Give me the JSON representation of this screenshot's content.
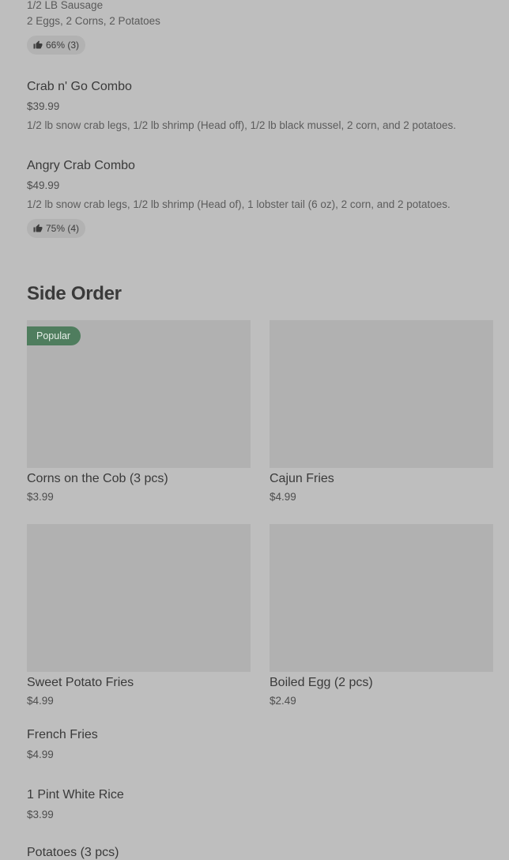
{
  "prev_item": {
    "line1": "1/2 LB Sausage",
    "line2": "2 Eggs, 2 Corns, 2 Potatoes",
    "rating": "66% (3)"
  },
  "items": [
    {
      "title": "Crab n' Go Combo",
      "price": "$39.99",
      "desc": "1/2 lb snow crab legs, 1/2 lb shrimp (Head off), 1/2 lb black mussel, 2 corn, and 2 potatoes."
    },
    {
      "title": "Angry Crab Combo",
      "price": "$49.99",
      "desc": "1/2 lb snow crab legs, 1/2 lb shrimp (Head of), 1 lobster tail (6 oz), 2 corn, and 2 potatoes.",
      "rating": "75% (4)"
    }
  ],
  "side_order": {
    "title": "Side Order",
    "popular_badge": "Popular",
    "cards": [
      {
        "title": "Corns on the Cob (3 pcs)",
        "price": "$3.99"
      },
      {
        "title": "Cajun Fries",
        "price": "$4.99"
      },
      {
        "title": "Sweet Potato Fries",
        "price": "$4.99"
      },
      {
        "title": "Boiled Egg (2 pcs)",
        "price": "$2.49"
      }
    ],
    "list": [
      {
        "title": "French Fries",
        "price": "$4.99"
      },
      {
        "title": "1 Pint White Rice",
        "price": "$3.99"
      },
      {
        "title": "Potatoes (3 pcs)"
      }
    ]
  },
  "icons": {
    "rating": "thumbs-up-icon"
  },
  "colors": {
    "overlay_bg": "#bebebe",
    "badge_bg": "#4f7d5e"
  }
}
